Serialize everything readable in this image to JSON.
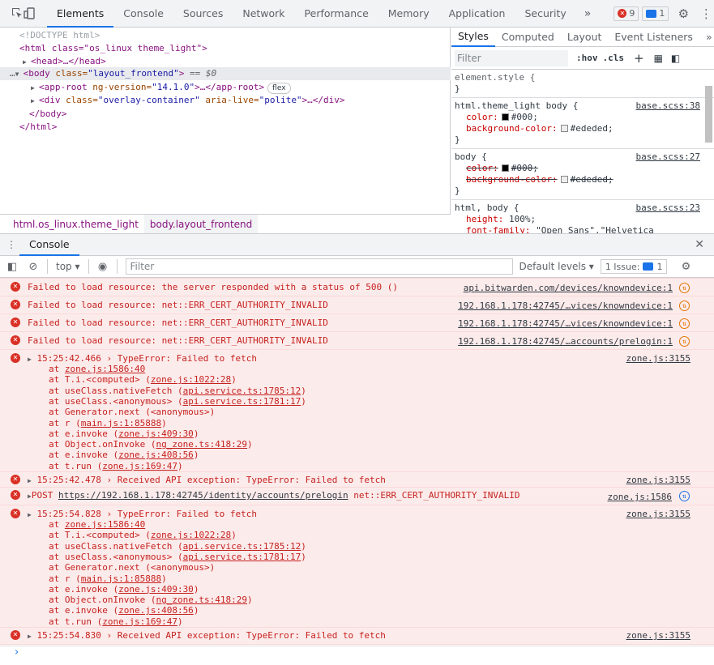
{
  "topbar": {
    "tabs": [
      "Elements",
      "Console",
      "Sources",
      "Network",
      "Performance",
      "Memory",
      "Application",
      "Security"
    ],
    "more": "»",
    "errors_count": "9",
    "messages_count": "1"
  },
  "elements": {
    "doctype": "<!DOCTYPE html>",
    "html_open": "<html class=\"os_linux theme_light\">",
    "head": "<head>…</head>",
    "body_open_tag": "<body",
    "body_attr": "class=",
    "body_val": "\"layout_frontend\"",
    "body_close_bracket": ">",
    "body_sel": "== $0",
    "approot_tag": "<app-root",
    "approot_attr": "ng-version=",
    "approot_val": "\"14.1.0\"",
    "approot_rest": ">…</app-root>",
    "flex_badge": "flex",
    "div_tag": "<div",
    "div_attr1": "class=",
    "div_val1": "\"overlay-container\"",
    "div_attr2": "aria-live=",
    "div_val2": "\"polite\"",
    "div_rest": ">…</div>",
    "body_close": "</body>",
    "html_close": "</html>",
    "breadcrumbs": [
      "html.os_linux.theme_light",
      "body.layout_frontend"
    ]
  },
  "styles": {
    "tabs": [
      "Styles",
      "Computed",
      "Layout",
      "Event Listeners"
    ],
    "more": "»",
    "filter_placeholder": "Filter",
    "hov": ":hov",
    "cls": ".cls",
    "rules": [
      {
        "selector": "element.style {",
        "close": "}"
      },
      {
        "selector": "html.theme_light body {",
        "source": "base.scss:38",
        "props": [
          "color:",
          "#000;",
          "background-color:",
          "#ededed;"
        ],
        "close": "}"
      },
      {
        "selector": "body {",
        "source": "base.scss:27",
        "props": [
          "color:",
          "#000;",
          "background-color:",
          "#ededed;"
        ],
        "close": "}"
      },
      {
        "selector": "html, body {",
        "source": "base.scss:23",
        "props": [
          "height:",
          "100%;",
          "font-family:",
          "\"Open Sans\",\"Helvetica"
        ]
      }
    ]
  },
  "drawer": {
    "tab": "Console",
    "context": "top ▾",
    "filter_placeholder": "Filter",
    "levels": "Default levels ▾",
    "issues_label": "1 Issue:",
    "issues_count": "1"
  },
  "console": {
    "messages": [
      {
        "text": "Failed to load resource: the server responded with a status of 500 ()",
        "source": "api.bitwarden.com/devices/knowndevice:1"
      },
      {
        "text": "Failed to load resource: net::ERR_CERT_AUTHORITY_INVALID",
        "source": "192.168.1.178:42745/…vices/knowndevice:1"
      },
      {
        "text": "Failed to load resource: net::ERR_CERT_AUTHORITY_INVALID",
        "source": "192.168.1.178:42745/…vices/knowndevice:1"
      },
      {
        "text": "Failed to load resource: net::ERR_CERT_AUTHORITY_INVALID",
        "source": "192.168.1.178:42745/…accounts/prelogin:1"
      }
    ],
    "trace1": {
      "head": "15:25:42.466 › TypeError: Failed to fetch",
      "source": "zone.js:3155",
      "lines": [
        [
          "at ",
          "zone.js:1586:40",
          ""
        ],
        [
          "at T.i.<computed> (",
          "zone.js:1022:28",
          ")"
        ],
        [
          "at useClass.nativeFetch (",
          "api.service.ts:1785:12",
          ")"
        ],
        [
          "at useClass.<anonymous> (",
          "api.service.ts:1781:17",
          ")"
        ],
        [
          "at Generator.next (<anonymous>)",
          "",
          ""
        ],
        [
          "at r (",
          "main.js:1:85888",
          ")"
        ],
        [
          "at e.invoke (",
          "zone.js:409:30",
          ")"
        ],
        [
          "at Object.onInvoke (",
          "ng_zone.ts:418:29",
          ")"
        ],
        [
          "at e.invoke (",
          "zone.js:408:56",
          ")"
        ],
        [
          "at t.run (",
          "zone.js:169:47",
          ")"
        ]
      ]
    },
    "api1": {
      "text": "15:25:42.478 › Received API exception: TypeError: Failed to fetch",
      "source": "zone.js:3155"
    },
    "post": {
      "method": "POST",
      "url": "https://192.168.1.178:42745/identity/accounts/prelogin",
      "err": "net::ERR_CERT_AUTHORITY_INVALID",
      "source": "zone.js:1586"
    },
    "trace2": {
      "head": "15:25:54.828 › TypeError: Failed to fetch",
      "source": "zone.js:3155",
      "lines": [
        [
          "at ",
          "zone.js:1586:40",
          ""
        ],
        [
          "at T.i.<computed> (",
          "zone.js:1022:28",
          ")"
        ],
        [
          "at useClass.nativeFetch (",
          "api.service.ts:1785:12",
          ")"
        ],
        [
          "at useClass.<anonymous> (",
          "api.service.ts:1781:17",
          ")"
        ],
        [
          "at Generator.next (<anonymous>)",
          "",
          ""
        ],
        [
          "at r (",
          "main.js:1:85888",
          ")"
        ],
        [
          "at e.invoke (",
          "zone.js:409:30",
          ")"
        ],
        [
          "at Object.onInvoke (",
          "ng_zone.ts:418:29",
          ")"
        ],
        [
          "at e.invoke (",
          "zone.js:408:56",
          ")"
        ],
        [
          "at t.run (",
          "zone.js:169:47",
          ")"
        ]
      ]
    },
    "api2": {
      "text": "15:25:54.830 › Received API exception: TypeError: Failed to fetch",
      "source": "zone.js:3155"
    },
    "prompt": "›"
  }
}
